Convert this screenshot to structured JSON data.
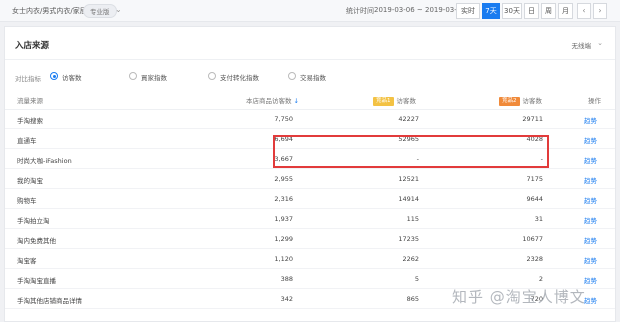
{
  "header": {
    "breadcrumb": "女士内衣/男式内衣/家居服",
    "badge": "专业版",
    "stat_label": "统计时间",
    "stat_range": "2019-03-06 ~ 2019-03-12",
    "periods": [
      "实时",
      "7天",
      "30天",
      "日",
      "周",
      "月"
    ],
    "active_period": "7天",
    "prev_icon": "chevron-left-icon",
    "next_icon": "chevron-right-icon"
  },
  "card": {
    "title": "入店来源",
    "device_select": "无线端",
    "metric_label": "对比指标",
    "metrics": [
      "访客数",
      "買家指数",
      "支付转化指数",
      "交易指数"
    ],
    "metric_selected": "访客数"
  },
  "table": {
    "headers": {
      "source": "流量来源",
      "shop_visitors": "本店商品访客数",
      "sort_icon": "↓",
      "comp1_tag": "竞品1",
      "comp1": "访客数",
      "comp2_tag": "竞品2",
      "comp2": "访客数",
      "action": "操作"
    },
    "rows": [
      {
        "name": "手淘搜索",
        "v1": "7,750",
        "v2": "42227",
        "v3": "29711",
        "op": "趋势"
      },
      {
        "name": "直通车",
        "v1": "6,694",
        "v2": "52965",
        "v3": "4028",
        "op": "趋势"
      },
      {
        "name": "时尚大咖-iFashion",
        "v1": "3,667",
        "v2": "-",
        "v3": "-",
        "op": "趋势"
      },
      {
        "name": "我的淘宝",
        "v1": "2,955",
        "v2": "12521",
        "v3": "7175",
        "op": "趋势"
      },
      {
        "name": "购物车",
        "v1": "2,316",
        "v2": "14914",
        "v3": "9644",
        "op": "趋势"
      },
      {
        "name": "手淘拍立淘",
        "v1": "1,937",
        "v2": "115",
        "v3": "31",
        "op": "趋势"
      },
      {
        "name": "淘内免费其他",
        "v1": "1,299",
        "v2": "17235",
        "v3": "10677",
        "op": "趋势"
      },
      {
        "name": "淘宝客",
        "v1": "1,120",
        "v2": "2262",
        "v3": "2328",
        "op": "趋势"
      },
      {
        "name": "手淘淘宝直播",
        "v1": "388",
        "v2": "5",
        "v3": "2",
        "op": "趋势"
      },
      {
        "name": "手淘其他店铺商品详情",
        "v1": "342",
        "v2": "865",
        "v3": "720",
        "op": "趋势"
      }
    ]
  },
  "watermark": {
    "text": "知乎 @淘宝人博文"
  },
  "colors": {
    "accent": "#1a7cf0",
    "highlight_border": "#e23b3b",
    "tag_yellow": "#f3c244",
    "tag_orange": "#f08a3a"
  }
}
